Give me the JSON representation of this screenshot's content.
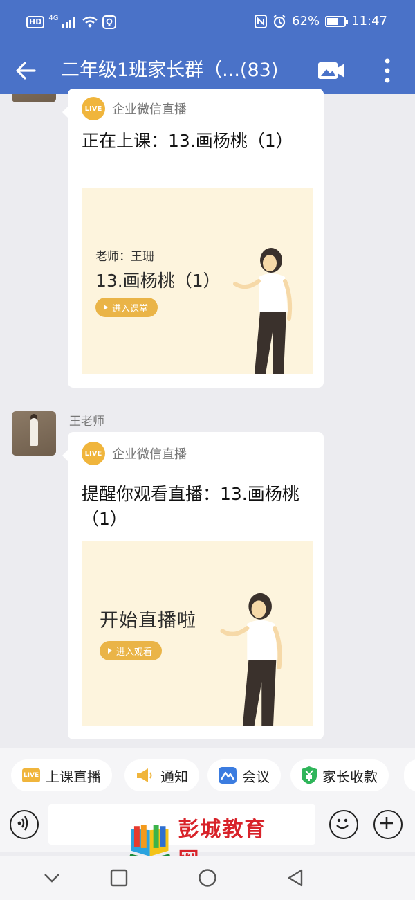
{
  "status_bar": {
    "network_label": "4G",
    "battery_level": 0.62,
    "battery_text": "62%",
    "time": "11:47",
    "icons": [
      "hd-icon",
      "signal-icon",
      "wifi-icon",
      "nfc-icon",
      "alarm-icon",
      "battery-icon"
    ]
  },
  "header": {
    "title": "二年级1班家长群（...(83)",
    "icons": [
      "back-arrow-icon",
      "video-camera-icon",
      "more-vertical-icon"
    ]
  },
  "messages": [
    {
      "sender": "",
      "source": "企业微信直播",
      "text": "正在上课：13.画杨桃（1）",
      "card": {
        "teacher": "老师：王珊",
        "lesson": "13.画杨桃（1）",
        "button": "进入课堂"
      }
    },
    {
      "sender": "王老师",
      "source": "企业微信直播",
      "text": "提醒你观看直播：13.画杨桃（1）",
      "card": {
        "headline": "开始直播啦",
        "button": "进入观看"
      }
    }
  ],
  "live_badge": "LIVE",
  "quick_actions": [
    {
      "label": "上课直播",
      "icon": "live-icon",
      "color": "#f0b53c"
    },
    {
      "label": "通知",
      "icon": "megaphone-icon",
      "color": "#f0b53c"
    },
    {
      "label": "会议",
      "icon": "meeting-icon",
      "color": "#3b7ce0"
    },
    {
      "label": "家长收款",
      "icon": "yuan-icon",
      "color": "#2fb55a"
    }
  ],
  "input_bar": {
    "icons": [
      "voice-icon",
      "emoji-icon",
      "plus-icon"
    ]
  },
  "watermark": {
    "text": "彭城教育网"
  },
  "nav_bar": {
    "icons": [
      "nav-down-icon",
      "nav-recent-icon",
      "nav-home-icon",
      "nav-back-icon"
    ]
  },
  "colors": {
    "header": "#4a72c8",
    "accent": "#eab447",
    "card_bg": "#fdf4dd",
    "watermark": "#d8232a"
  }
}
